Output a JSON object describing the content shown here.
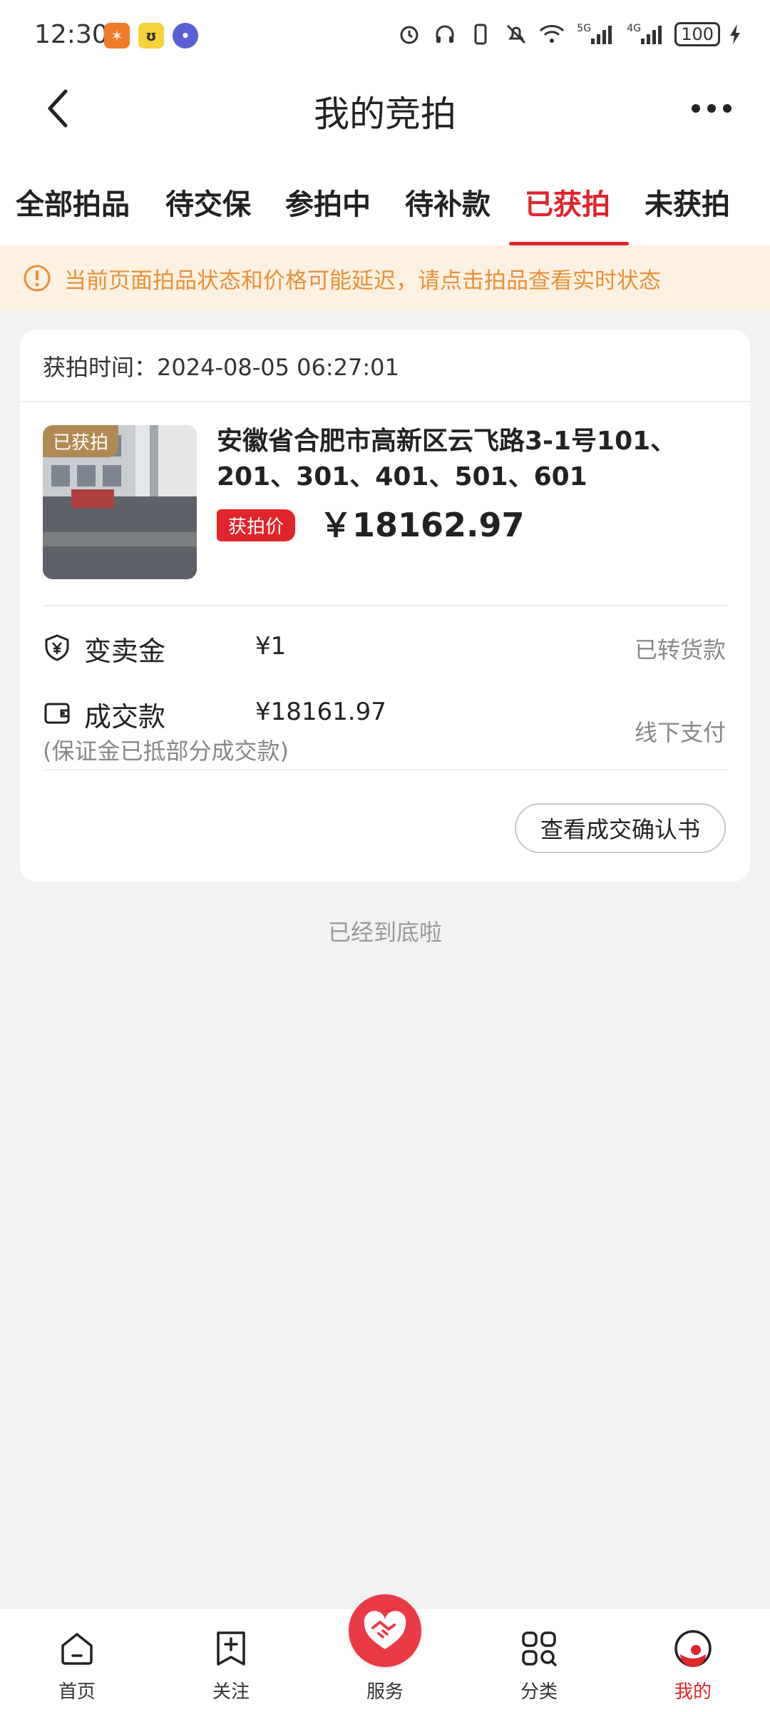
{
  "status_bar": {
    "time": "12:30",
    "battery": "100",
    "signal_1": "5G",
    "signal_2": "4G"
  },
  "header": {
    "title": "我的竞拍"
  },
  "tabs": [
    {
      "label": "全部拍品",
      "active": false
    },
    {
      "label": "待交保",
      "active": false
    },
    {
      "label": "参拍中",
      "active": false
    },
    {
      "label": "待补款",
      "active": false
    },
    {
      "label": "已获拍",
      "active": true
    },
    {
      "label": "未获拍",
      "active": false
    }
  ],
  "notice": {
    "text": "当前页面拍品状态和价格可能延迟，请点击拍品查看实时状态"
  },
  "card": {
    "won_time": "获拍时间：2024-08-05 06:27:01",
    "badge": "已获拍",
    "title": "安徽省合肥市高新区云飞路3-1号101、201、301、401、501、601",
    "price_tag": "获拍价",
    "price": "￥18162.97",
    "rows": [
      {
        "label": "变卖金",
        "value": "¥1",
        "status": "已转货款"
      },
      {
        "label": "成交款",
        "value": "¥18161.97",
        "status": "线下支付",
        "note": "(保证金已抵部分成交款)"
      }
    ],
    "confirm_button": "查看成交确认书"
  },
  "bottom_tip": "已经到底啦",
  "bottom_nav": [
    {
      "label": "首页",
      "icon": "home-icon"
    },
    {
      "label": "关注",
      "icon": "bookmark-plus-icon"
    },
    {
      "label": "服务",
      "icon": "handshake-icon"
    },
    {
      "label": "分类",
      "icon": "category-icon"
    },
    {
      "label": "我的",
      "icon": "profile-icon"
    }
  ],
  "colors": {
    "accent": "#e0252b",
    "notice_bg": "#fdf1e1",
    "notice_text": "#e8913a",
    "badge_gold": "#b08a52"
  }
}
